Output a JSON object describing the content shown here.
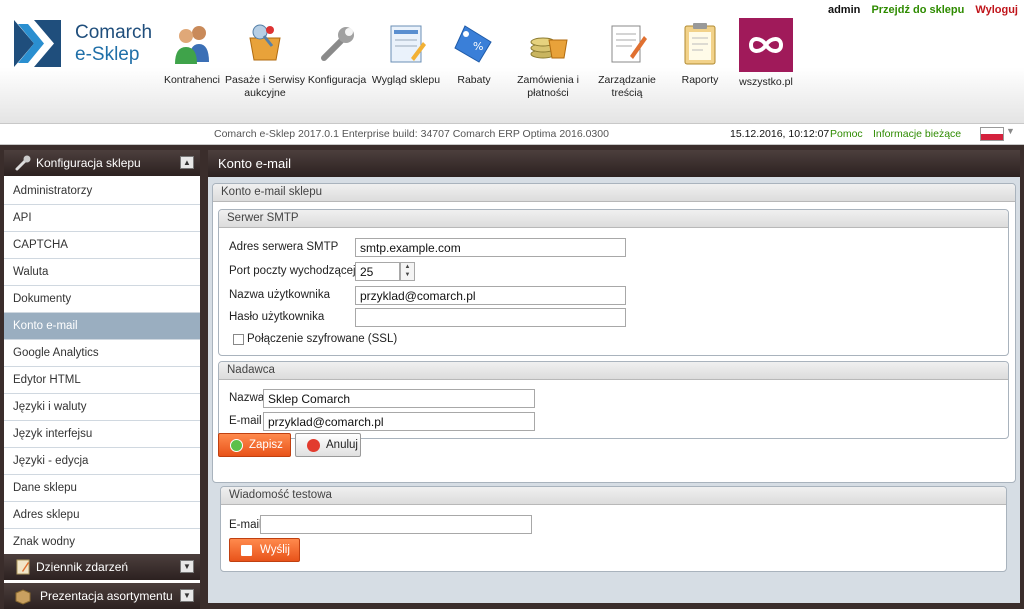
{
  "app": {
    "logo_line1": "Comarch",
    "logo_line2": "e-Sklep"
  },
  "topright": {
    "user": "admin",
    "go_to_shop": "Przejdź do sklepu",
    "logout": "Wyloguj"
  },
  "nav": [
    {
      "label": "Kontrahenci",
      "icon": "users-icon"
    },
    {
      "label": "Pasaże i Serwisy aukcyjne",
      "icon": "auction-basket-icon"
    },
    {
      "label": "Konfiguracja",
      "icon": "wrench-icon"
    },
    {
      "label": "Wygląd sklepu",
      "icon": "page-design-icon"
    },
    {
      "label": "Rabaty",
      "icon": "discount-tag-icon"
    },
    {
      "label": "Zamówienia i płatności",
      "icon": "orders-coins-icon"
    },
    {
      "label": "Zarządzanie treścią",
      "icon": "content-edit-icon"
    },
    {
      "label": "Raporty",
      "icon": "clipboard-icon"
    },
    {
      "label": "wszystko.pl",
      "icon": "wszystko-logo-icon"
    }
  ],
  "infobar": {
    "build": "Comarch e-Sklep 2017.0.1 Enterprise build: 34707 Comarch ERP Optima 2016.0300",
    "datetime": "15.12.2016, 10:12:07",
    "help": "Pomoc",
    "news": "Informacje bieżące"
  },
  "sidebar": {
    "section_title": "Konfiguracja sklepu",
    "items": [
      "Administratorzy",
      "API",
      "CAPTCHA",
      "Waluta",
      "Dokumenty",
      "Konto e-mail",
      "Google Analytics",
      "Edytor HTML",
      "Języki i waluty",
      "Język interfejsu",
      "Języki - edycja",
      "Dane sklepu",
      "Adres sklepu",
      "Znak wodny"
    ],
    "active_index": 5,
    "section2_title": "Dziennik zdarzeń",
    "section3_title": "Prezentacja asortymentu"
  },
  "main": {
    "title": "Konto e-mail",
    "outer_panel_title": "Konto e-mail sklepu",
    "smtp": {
      "title": "Serwer SMTP",
      "server_label": "Adres serwera SMTP",
      "server_value": "smtp.example.com",
      "port_label": "Port poczty wychodzącej",
      "port_value": "25",
      "user_label": "Nazwa użytkownika",
      "user_value": "przyklad@comarch.pl",
      "password_label": "Hasło użytkownika",
      "password_value": "",
      "ssl_label": "Połączenie szyfrowane (SSL)",
      "ssl_checked": false
    },
    "sender": {
      "title": "Nadawca",
      "name_label": "Nazwa",
      "name_value": "Sklep Comarch",
      "email_label": "E-mail",
      "email_value": "przyklad@comarch.pl"
    },
    "save_label": "Zapisz",
    "cancel_label": "Anuluj",
    "test": {
      "title": "Wiadomość testowa",
      "email_label": "E-mail",
      "email_value": "",
      "send_label": "Wyślij"
    }
  }
}
